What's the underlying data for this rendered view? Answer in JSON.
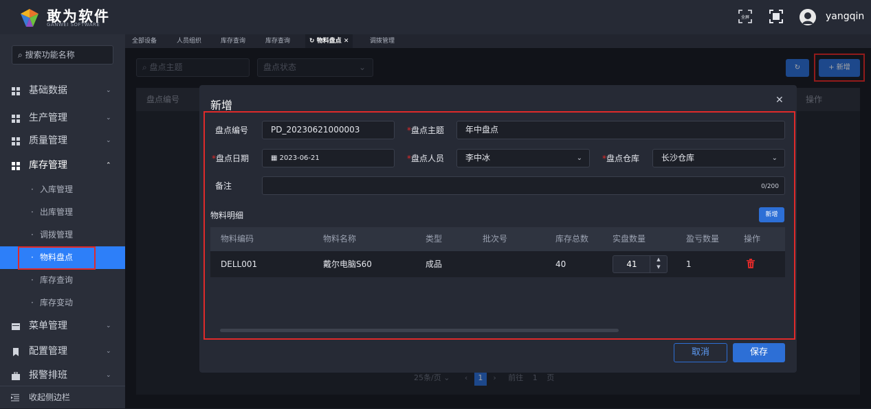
{
  "header": {
    "logo_name": "敢为软件",
    "logo_sub": "GANWEI SOFTWARE",
    "fullscreen_label": "全屏",
    "username": "yangqin"
  },
  "sidebar": {
    "search_placeholder": "搜索功能名称",
    "menus": [
      {
        "label": "基础数据",
        "icon": "grid-icon"
      },
      {
        "label": "生产管理",
        "icon": "grid-icon"
      },
      {
        "label": "质量管理",
        "icon": "grid-icon"
      },
      {
        "label": "库存管理",
        "icon": "grid-icon"
      }
    ],
    "sub_items": [
      "入库管理",
      "出库管理",
      "调拨管理",
      "物料盘点",
      "库存查询",
      "库存变动"
    ],
    "menus_bottom": [
      {
        "label": "菜单管理",
        "icon": "table-icon"
      },
      {
        "label": "配置管理",
        "icon": "bookmark-icon"
      },
      {
        "label": "报警排班",
        "icon": "briefcase-icon"
      }
    ],
    "collapse_label": "收起侧边栏"
  },
  "tabs": [
    "全部设备",
    "人员组织",
    "库存查询",
    "库存查询",
    "物料盘点",
    "调拨管理"
  ],
  "list_page": {
    "search_placeholder": "盘点主题",
    "status_placeholder": "盘点状态",
    "new_button": "新增",
    "col_first": "盘点编号",
    "col_last": "操作",
    "pager": {
      "page_size": "25条/页",
      "current": "1",
      "goto_label": "前往",
      "goto_value": "1",
      "page_unit": "页"
    }
  },
  "modal": {
    "title": "新增",
    "fields": {
      "code_label": "盘点编号",
      "code_value": "PD_20230621000003",
      "subject_label": "盘点主题",
      "subject_value": "年中盘点",
      "date_label": "盘点日期",
      "date_value": "2023-06-21",
      "person_label": "盘点人员",
      "person_value": "李中冰",
      "warehouse_label": "盘点仓库",
      "warehouse_value": "长沙仓库",
      "remark_label": "备注",
      "remark_counter": "0/200"
    },
    "detail_title": "物料明细",
    "add_button": "新增",
    "columns": [
      "物料编码",
      "物料名称",
      "类型",
      "批次号",
      "库存总数",
      "实盘数量",
      "盈亏数量",
      "操作"
    ],
    "rows": [
      {
        "code": "DELL001",
        "name": "戴尔电脑S60",
        "type": "成品",
        "batch": "",
        "stock": "40",
        "actual": "41",
        "diff": "1"
      }
    ],
    "cancel_button": "取消",
    "save_button": "保存"
  },
  "colors": {
    "accent": "#2d7ff9",
    "danger": "#e02a2a",
    "background": "#1b1e27"
  }
}
